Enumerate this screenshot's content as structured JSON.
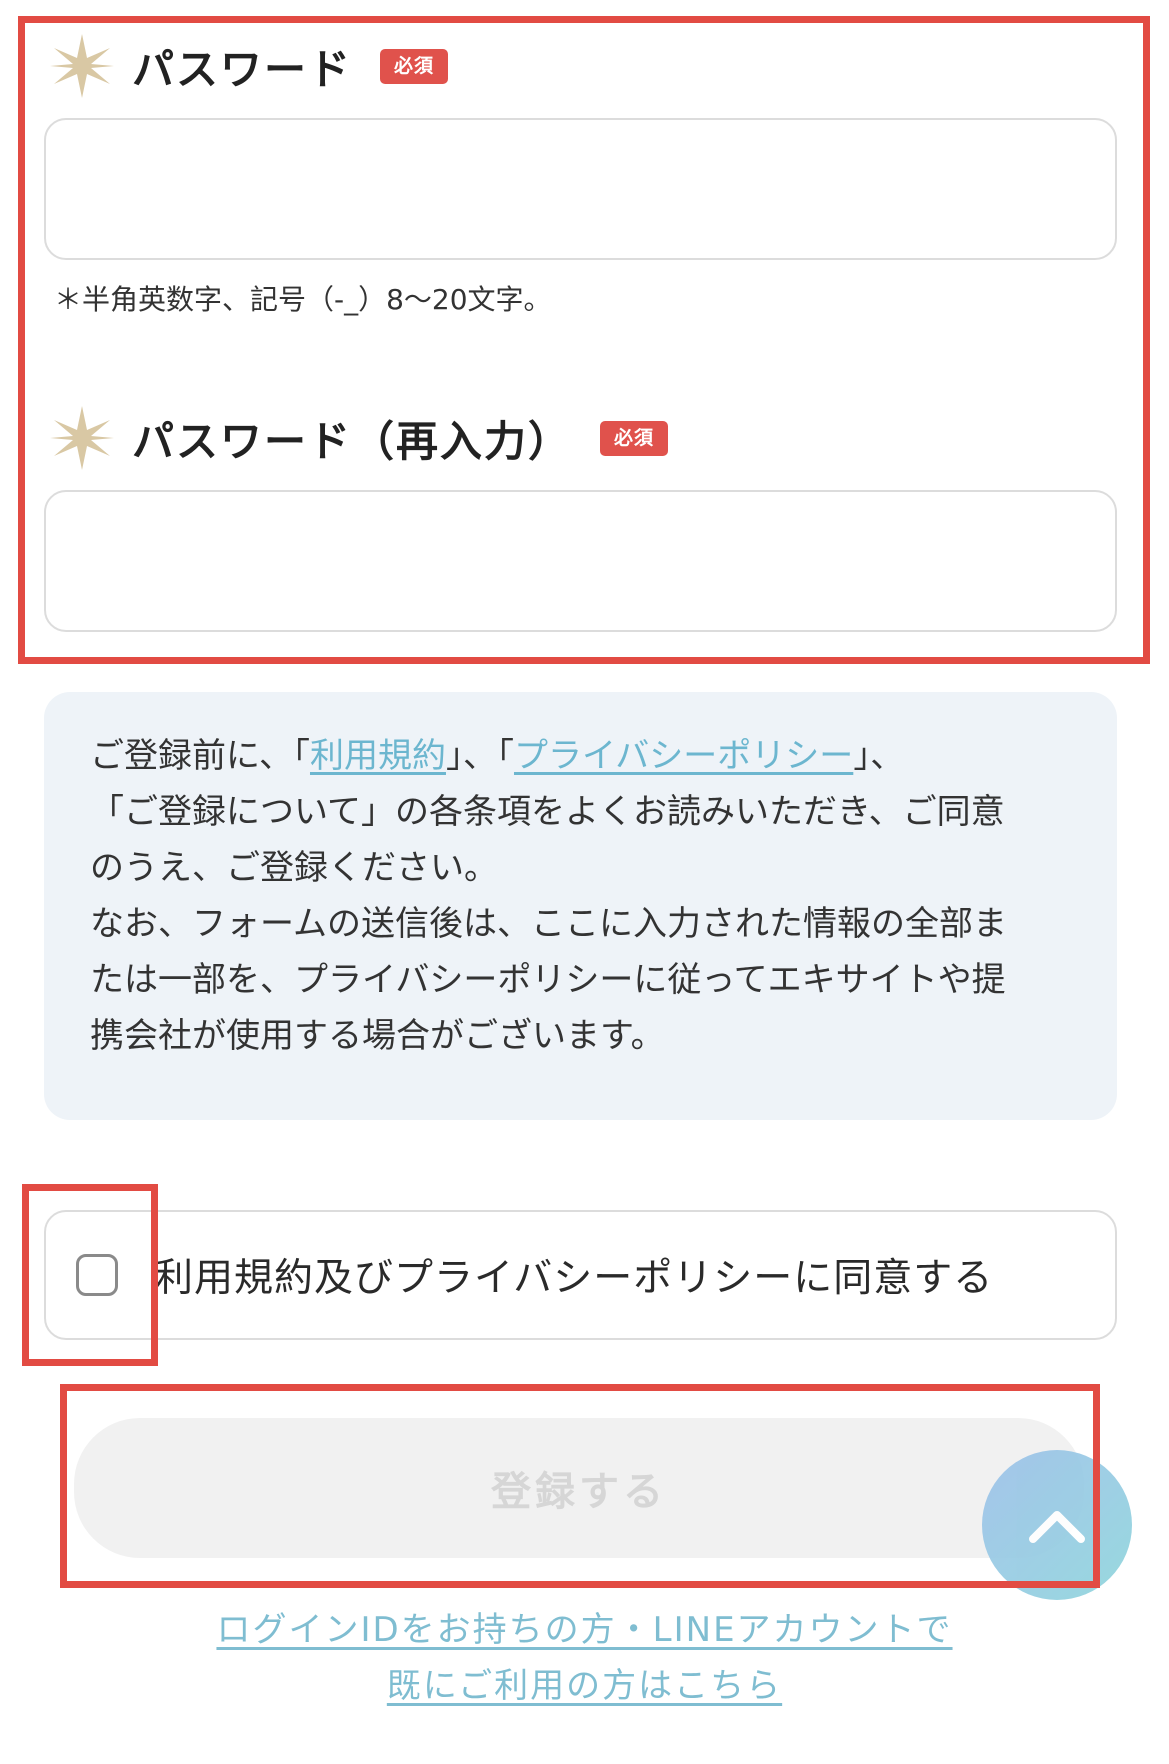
{
  "password": {
    "label": "パスワード",
    "required_badge": "必須",
    "value": "",
    "hint": "＊半角英数字、記号（-_）8〜20文字。"
  },
  "password_confirm": {
    "label": "パスワード（再入力）",
    "required_badge": "必須",
    "value": ""
  },
  "notice": {
    "line1_pre": "ご登録前に、「",
    "terms_link": "利用規約",
    "line1_mid": "」、「",
    "privacy_link": "プライバシーポリシー",
    "line1_post": "」、",
    "line2": "「ご登録について」の各条項をよくお読みいただき、ご同意",
    "line3": "のうえ、ご登録ください。",
    "line4": "なお、フォームの送信後は、ここに入力された情報の全部ま",
    "line5": "たは一部を、プライバシーポリシーに従ってエキサイトや提",
    "line6": "携会社が使用する場合がございます。"
  },
  "agreement": {
    "label": "利用規約及びプライバシーポリシーに同意する",
    "checked": false
  },
  "submit": {
    "label": "登録する"
  },
  "login_link": {
    "line1": "ログインIDをお持ちの方・LINEアカウントで",
    "line2": "既にご利用の方はこちら"
  },
  "icons": {
    "star": "star-icon",
    "scroll_top": "chevron-up-icon"
  },
  "colors": {
    "annotation_frame": "#e24b43",
    "required_badge": "#e0524c",
    "link": "#6cb6cf",
    "star": "#d9c8a4",
    "notice_background": "#eef3f8"
  }
}
